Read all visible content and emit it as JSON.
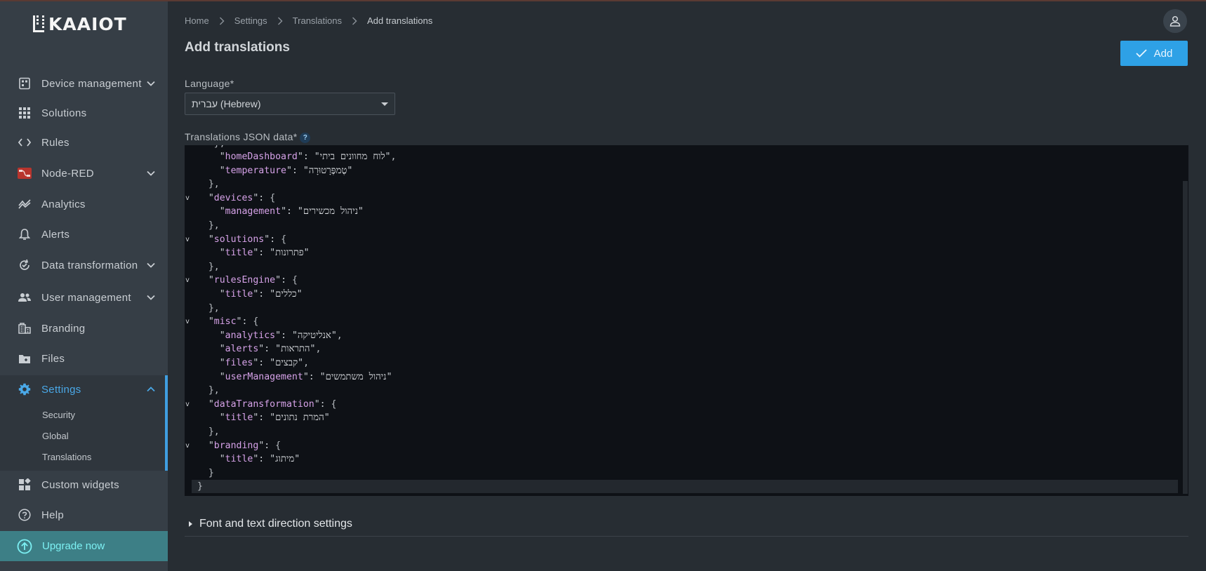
{
  "app": {
    "logo_text": "KAAIOT"
  },
  "sidebar": {
    "items": [
      {
        "label": "Device management",
        "icon": "device-icon",
        "expandable": true
      },
      {
        "label": "Solutions",
        "icon": "grid-icon",
        "expandable": false
      },
      {
        "label": "Rules",
        "icon": "code-icon",
        "expandable": false
      },
      {
        "label": "Node-RED",
        "icon": "node-red-icon",
        "expandable": true
      },
      {
        "label": "Analytics",
        "icon": "analytics-icon",
        "expandable": false
      },
      {
        "label": "Alerts",
        "icon": "bell-icon",
        "expandable": false
      },
      {
        "label": "Data transformation",
        "icon": "transform-icon",
        "expandable": true
      },
      {
        "label": "User management",
        "icon": "users-icon",
        "expandable": true
      },
      {
        "label": "Branding",
        "icon": "branding-icon",
        "expandable": false
      },
      {
        "label": "Files",
        "icon": "files-icon",
        "expandable": false
      },
      {
        "label": "Settings",
        "icon": "gear-icon",
        "expandable": true,
        "active": true
      },
      {
        "label": "Custom widgets",
        "icon": "widgets-icon",
        "expandable": false
      },
      {
        "label": "Help",
        "icon": "help-icon",
        "expandable": false
      }
    ],
    "settings_sub": [
      "Security",
      "Global",
      "Translations"
    ],
    "upgrade_label": "Upgrade now"
  },
  "breadcrumb": [
    "Home",
    "Settings",
    "Translations",
    "Add translations"
  ],
  "page": {
    "title": "Add translations",
    "add_label": "Add",
    "language_label": "Language*",
    "language_value": "עברית (Hebrew)",
    "json_label": "Translations JSON data*",
    "help_glyph": "?",
    "font_section_label": "Font and text direction settings"
  },
  "editor": {
    "lines": [
      {
        "indent": 4,
        "key": "homeDashboard",
        "value": "לוח מחוונים ביתי",
        "tail": ",",
        "fold": false
      },
      {
        "indent": 4,
        "key": "temperature",
        "value": "טֶמפֶּרָטוּרָה",
        "tail": "",
        "fold": false
      },
      {
        "indent": 2,
        "text": "},",
        "fold": false
      },
      {
        "indent": 2,
        "key": "devices",
        "open": "{",
        "fold": true
      },
      {
        "indent": 4,
        "key": "management",
        "value": "ניהול מכשירים",
        "tail": "",
        "fold": false
      },
      {
        "indent": 2,
        "text": "},",
        "fold": false
      },
      {
        "indent": 2,
        "key": "solutions",
        "open": "{",
        "fold": true
      },
      {
        "indent": 4,
        "key": "title",
        "value": "פתרונות",
        "tail": "",
        "fold": false
      },
      {
        "indent": 2,
        "text": "},",
        "fold": false
      },
      {
        "indent": 2,
        "key": "rulesEngine",
        "open": "{",
        "fold": true
      },
      {
        "indent": 4,
        "key": "title",
        "value": "כללים",
        "tail": "",
        "fold": false
      },
      {
        "indent": 2,
        "text": "},",
        "fold": false
      },
      {
        "indent": 2,
        "key": "misc",
        "open": "{",
        "fold": true
      },
      {
        "indent": 4,
        "key": "analytics",
        "value": "אנליטיקה",
        "tail": ",",
        "fold": false
      },
      {
        "indent": 4,
        "key": "alerts",
        "value": "התראות",
        "tail": ",",
        "fold": false
      },
      {
        "indent": 4,
        "key": "files",
        "value": "קבצים",
        "tail": ",",
        "fold": false
      },
      {
        "indent": 4,
        "key": "userManagement",
        "value": "ניהול משתמשים",
        "tail": "",
        "fold": false
      },
      {
        "indent": 2,
        "text": "},",
        "fold": false
      },
      {
        "indent": 2,
        "key": "dataTransformation",
        "open": "{",
        "fold": true
      },
      {
        "indent": 4,
        "key": "title",
        "value": "המרת נתונים",
        "tail": "",
        "fold": false
      },
      {
        "indent": 2,
        "text": "},",
        "fold": false
      },
      {
        "indent": 2,
        "key": "branding",
        "open": "{",
        "fold": true
      },
      {
        "indent": 4,
        "key": "title",
        "value": "מיתוג",
        "tail": "",
        "fold": false
      },
      {
        "indent": 2,
        "text": "}",
        "fold": false
      },
      {
        "indent": 0,
        "text": "}",
        "fold": false,
        "current": true
      }
    ]
  },
  "colors": {
    "accent": "#2ea1e6",
    "sidebar_bg": "#363e46",
    "main_bg": "#272d33",
    "editor_bg": "#0e1116",
    "json_key": "#d6a2e8",
    "upgrade_bg": "#3d7f86"
  }
}
